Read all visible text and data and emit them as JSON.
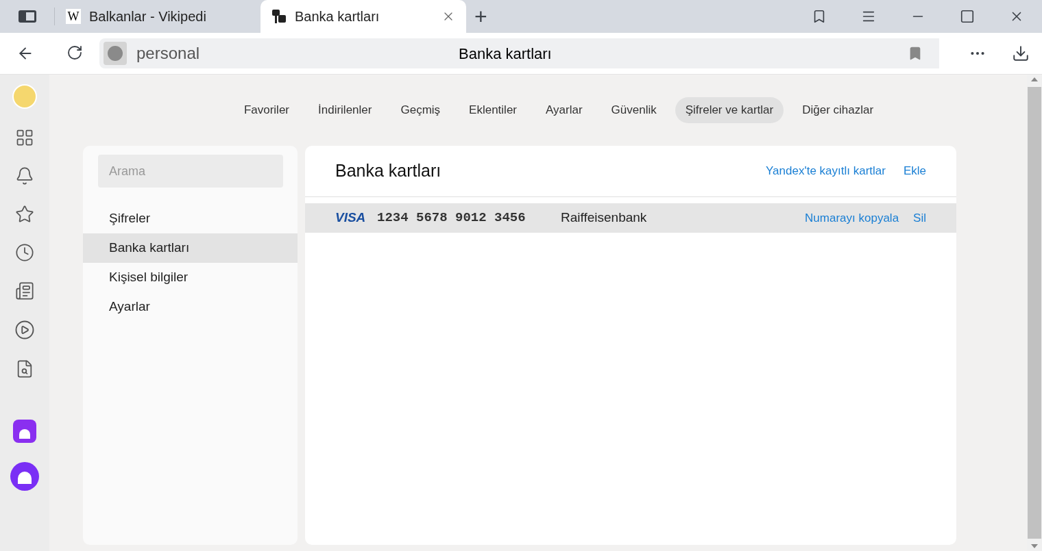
{
  "browser_tabs": [
    {
      "title": "Balkanlar - Vikipedi",
      "favicon": "W",
      "selected": false
    },
    {
      "title": "Banka kartları",
      "selected": true
    }
  ],
  "new_tab": "+",
  "address_bar": {
    "host": "personal",
    "title": "Banka kartları"
  },
  "settings_nav": [
    {
      "label": "Favoriler",
      "selected": false
    },
    {
      "label": "İndirilenler",
      "selected": false
    },
    {
      "label": "Geçmiş",
      "selected": false
    },
    {
      "label": "Eklentiler",
      "selected": false
    },
    {
      "label": "Ayarlar",
      "selected": false
    },
    {
      "label": "Güvenlik",
      "selected": false
    },
    {
      "label": "Şifreler ve kartlar",
      "selected": true
    },
    {
      "label": "Diğer cihazlar",
      "selected": false
    }
  ],
  "search": {
    "placeholder": "Arama"
  },
  "side_menu": [
    {
      "label": "Şifreler",
      "selected": false
    },
    {
      "label": "Banka kartları",
      "selected": true
    },
    {
      "label": "Kişisel bilgiler",
      "selected": false
    },
    {
      "label": "Ayarlar",
      "selected": false
    }
  ],
  "panel": {
    "title": "Banka kartları",
    "links": [
      "Yandex'te kayıtlı kartlar",
      "Ekle"
    ]
  },
  "cards": [
    {
      "brand": "VISA",
      "number": "1234 5678 9012 3456",
      "bank": "Raiffeisenbank",
      "actions": [
        "Numarayı kopyala",
        "Sil"
      ],
      "selected": true
    }
  ]
}
